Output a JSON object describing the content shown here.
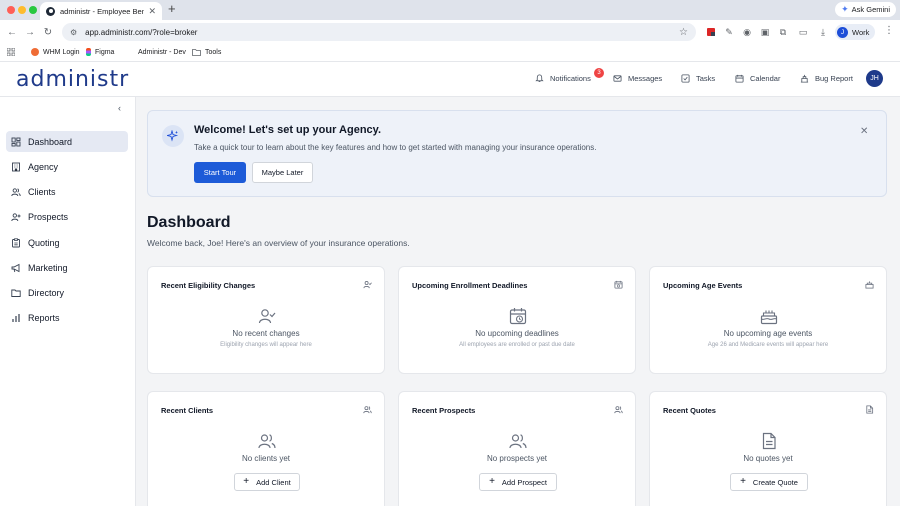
{
  "browser": {
    "tab_title": "administr - Employee Benefit",
    "new_tab": "+",
    "gemini_label": "Ask Gemini",
    "url": "app.administr.com/?role=broker",
    "profile_initial": "J",
    "profile_label": "Work",
    "bookmarks": [
      "WHM Login",
      "Figma",
      "Administr - Dev",
      "Tools"
    ]
  },
  "header": {
    "logo": "administr",
    "nav": {
      "notifications": "Notifications",
      "notifications_count": "3",
      "messages": "Messages",
      "tasks": "Tasks",
      "calendar": "Calendar",
      "bug_report": "Bug Report"
    },
    "user_initials": "JH"
  },
  "sidebar": {
    "items": [
      {
        "label": "Dashboard",
        "icon": "dashboard-icon",
        "active": true
      },
      {
        "label": "Agency",
        "icon": "building-icon"
      },
      {
        "label": "Clients",
        "icon": "users-icon"
      },
      {
        "label": "Prospects",
        "icon": "user-plus-icon"
      },
      {
        "label": "Quoting",
        "icon": "clipboard-icon"
      },
      {
        "label": "Marketing",
        "icon": "megaphone-icon"
      },
      {
        "label": "Directory",
        "icon": "folder-icon"
      },
      {
        "label": "Reports",
        "icon": "bar-chart-icon"
      }
    ]
  },
  "welcome": {
    "title": "Welcome! Let's set up your Agency.",
    "description": "Take a quick tour to learn about the key features and how to get started with managing your insurance operations.",
    "primary": "Start Tour",
    "secondary": "Maybe Later"
  },
  "page": {
    "title": "Dashboard",
    "subtitle": "Welcome back, Joe! Here's an overview of your insurance operations."
  },
  "cards": [
    {
      "title": "Recent Eligibility Changes",
      "empty": "No recent changes",
      "hint": "Eligibility changes will appear here"
    },
    {
      "title": "Upcoming Enrollment Deadlines",
      "empty": "No upcoming deadlines",
      "hint": "All employees are enrolled or past due date"
    },
    {
      "title": "Upcoming Age Events",
      "empty": "No upcoming age events",
      "hint": "Age 26 and Medicare events will appear here"
    },
    {
      "title": "Recent Clients",
      "empty": "No clients yet",
      "button": "Add Client"
    },
    {
      "title": "Recent Prospects",
      "empty": "No prospects yet",
      "button": "Add Prospect"
    },
    {
      "title": "Recent Quotes",
      "empty": "No quotes yet",
      "button": "Create Quote"
    }
  ],
  "colors": {
    "primary": "#1d5bd8",
    "brand": "#1f3a8a",
    "badge": "#ef4444"
  }
}
